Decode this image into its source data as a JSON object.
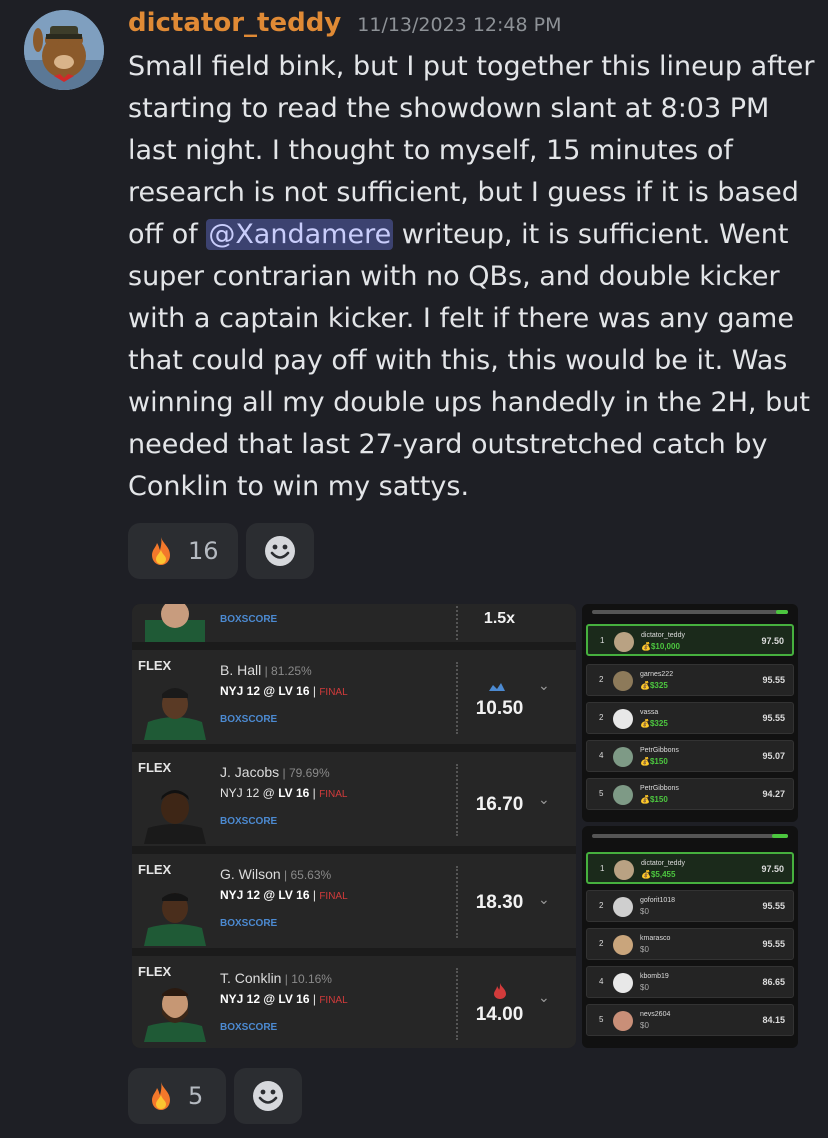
{
  "message": {
    "username": "dictator_teddy",
    "timestamp": "11/13/2023 12:48 PM",
    "text_before": "Small field bink, but I put together this lineup after starting to read the showdown slant at 8:03 PM last night. I thought to myself, 15 minutes of research is not sufficient, but I guess if it is based off of ",
    "mention": "@Xandamere",
    "text_after": " writeup, it is sufficient. Went super contrarian with no QBs, and double kicker with a captain kicker. I felt if there was any game that could pay off with this, this would be it. Was winning all my double ups handedly in the 2H, but needed that last 27-yard outstretched catch by Conklin to win my sattys."
  },
  "reactions_top": [
    {
      "icon": "fire-emoji",
      "count": "16"
    },
    {
      "icon": "add-reaction-smile-icon"
    }
  ],
  "reactions_bottom": [
    {
      "icon": "fire-emoji",
      "count": "5"
    },
    {
      "icon": "add-reaction-smile-icon"
    }
  ],
  "lineup": {
    "top_partial": {
      "boxscore": "BOXSCORE",
      "multiplier": "1.5x"
    },
    "players": [
      {
        "slot": "FLEX",
        "name": "B. Hall",
        "pct": "81.25%",
        "game_pre": "NYJ 12 @ LV 16",
        "game_bold": "",
        "final": "FINAL",
        "boxscore": "BOXSCORE",
        "points": "10.50",
        "tier_icon": "ice-icon"
      },
      {
        "slot": "FLEX",
        "name": "J. Jacobs",
        "pct": "79.69%",
        "game_pre": "NYJ 12 @ ",
        "game_bold": "LV 16",
        "final": "FINAL",
        "boxscore": "BOXSCORE",
        "points": "16.70",
        "tier_icon": ""
      },
      {
        "slot": "FLEX",
        "name": "G. Wilson",
        "pct": "65.63%",
        "game_pre": "NYJ 12 @ LV 16",
        "game_bold": "",
        "final": "FINAL",
        "boxscore": "BOXSCORE",
        "points": "18.30",
        "tier_icon": ""
      },
      {
        "slot": "FLEX",
        "name": "T. Conklin",
        "pct": "10.16%",
        "game_pre": "NYJ 12 @ LV 16",
        "game_bold": "",
        "final": "FINAL",
        "boxscore": "BOXSCORE",
        "points": "14.00",
        "tier_icon": "fire-icon"
      }
    ]
  },
  "leaderboard_1": {
    "progress": 0.06,
    "rows": [
      {
        "rank": "1",
        "name": "dictator_teddy",
        "prize": "$10,000",
        "score": "97.50",
        "me": true
      },
      {
        "rank": "2",
        "name": "garnes222",
        "prize": "$325",
        "score": "95.55"
      },
      {
        "rank": "2",
        "name": "vassa",
        "prize": "$325",
        "score": "95.55"
      },
      {
        "rank": "4",
        "name": "PetrGibbons",
        "prize": "$150",
        "score": "95.07"
      },
      {
        "rank": "5",
        "name": "PetrGibbons",
        "prize": "$150",
        "score": "94.27"
      }
    ]
  },
  "leaderboard_2": {
    "progress": 0.08,
    "rows": [
      {
        "rank": "1",
        "name": "dictator_teddy",
        "prize": "$5,455",
        "score": "97.50",
        "me": true
      },
      {
        "rank": "2",
        "name": "goforit1018",
        "prize": "$0",
        "score": "95.55"
      },
      {
        "rank": "2",
        "name": "kmarasco",
        "prize": "$0",
        "score": "95.55"
      },
      {
        "rank": "4",
        "name": "kbomb19",
        "prize": "$0",
        "score": "86.65"
      },
      {
        "rank": "5",
        "name": "nevs2604",
        "prize": "$0",
        "score": "84.15"
      }
    ]
  },
  "colors": {
    "username": "#e08a35",
    "mention_bg": "#3c4270",
    "final": "#d23b3b",
    "boxscore": "#4c8ad1",
    "winner_border": "#46b03e"
  }
}
